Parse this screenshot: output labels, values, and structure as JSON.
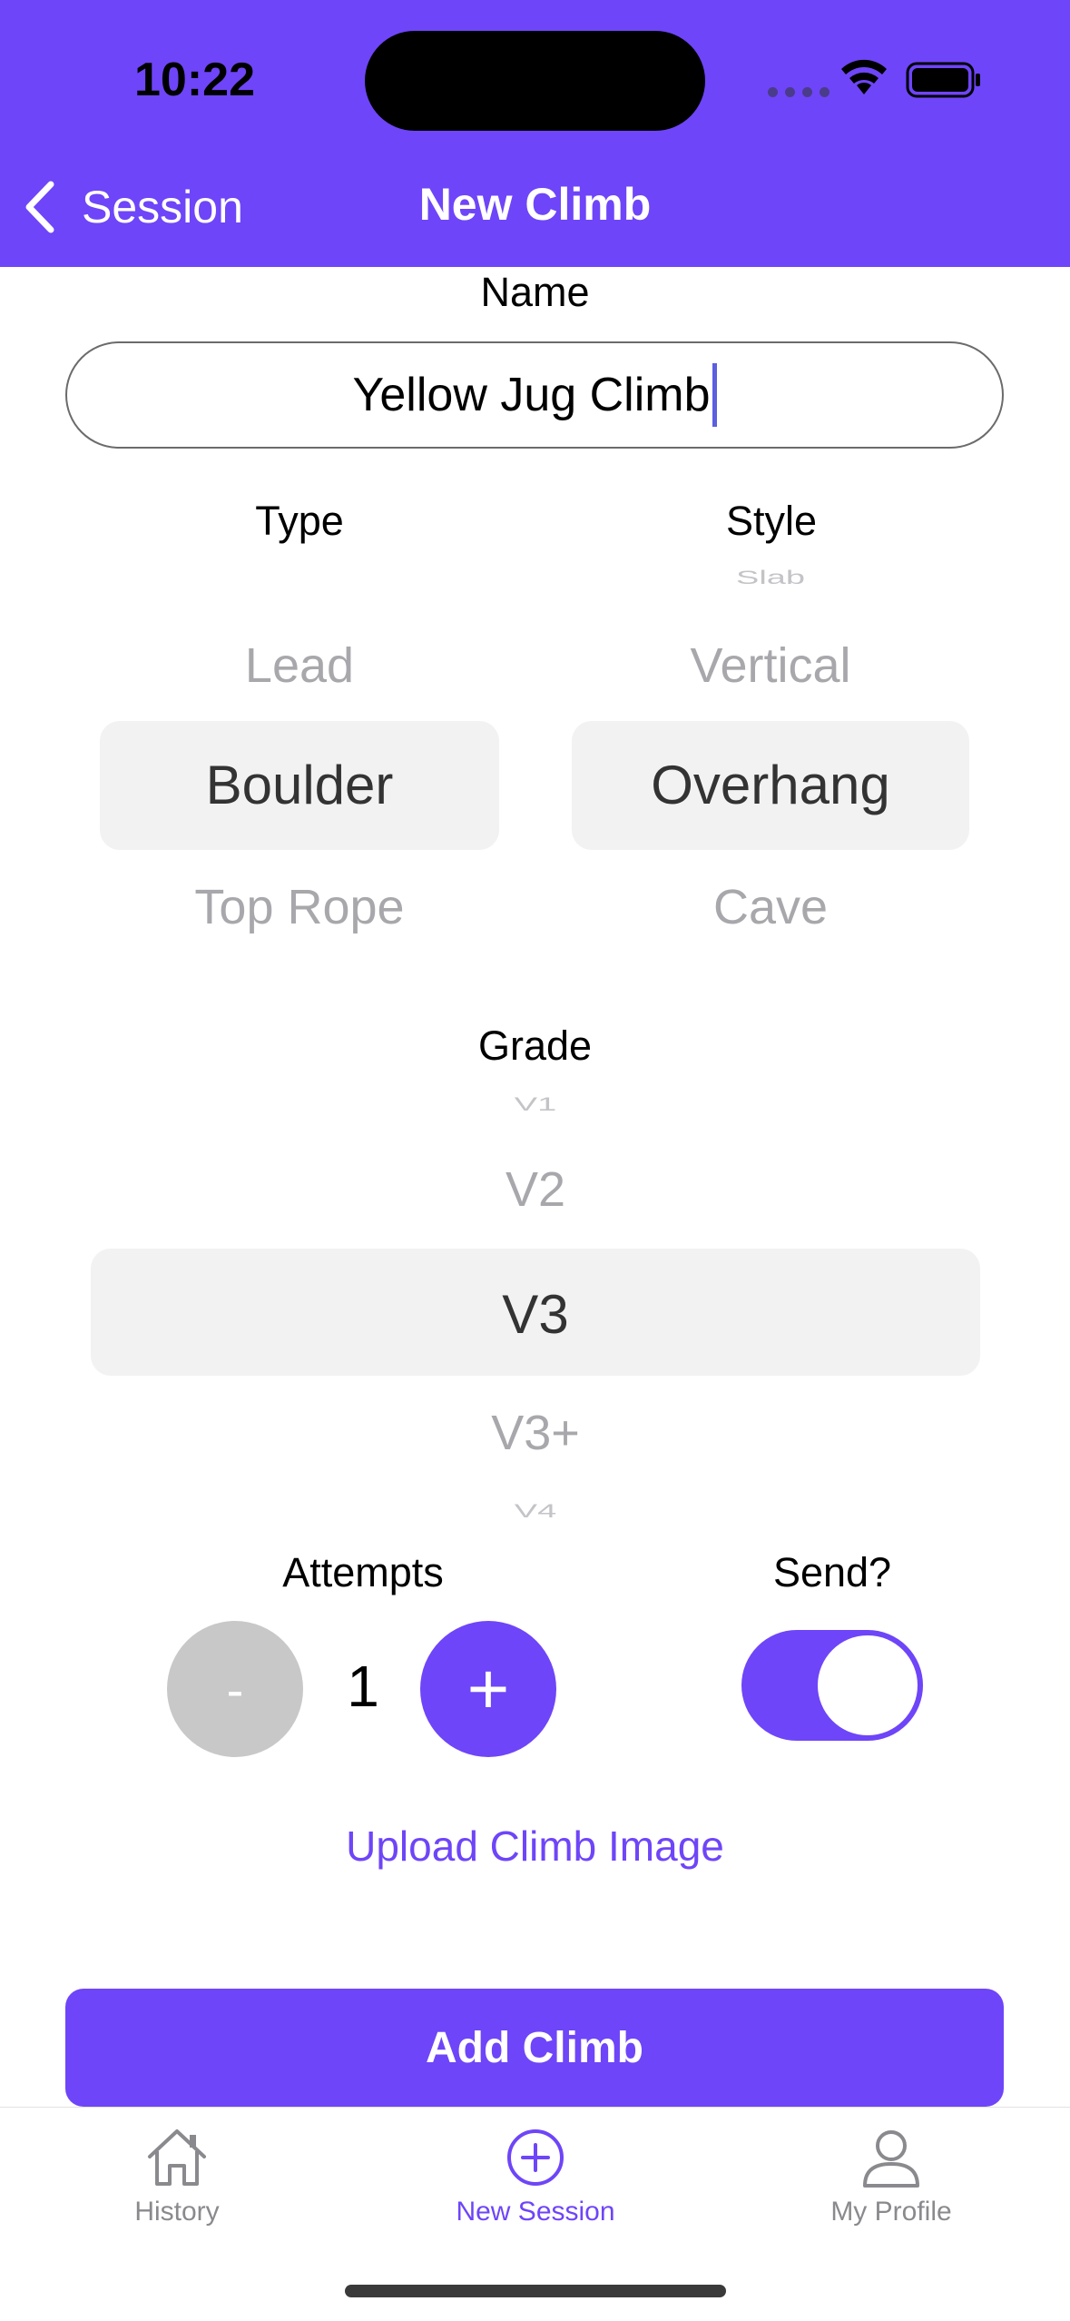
{
  "status_bar": {
    "time": "10:22"
  },
  "nav": {
    "back_label": "Session",
    "title": "New Climb"
  },
  "form": {
    "name_label": "Name",
    "name_value": "Yellow Jug Climb",
    "type_label": "Type",
    "style_label": "Style",
    "grade_label": "Grade",
    "attempts_label": "Attempts",
    "send_label": "Send?"
  },
  "type_picker": {
    "above": "Lead",
    "selected": "Boulder",
    "below": "Top Rope"
  },
  "style_picker": {
    "above2": "Slab",
    "above": "Vertical",
    "selected": "Overhang",
    "below": "Cave"
  },
  "grade_picker": {
    "above2": "V1",
    "above": "V2",
    "selected": "V3",
    "below": "V3+",
    "below2": "V4"
  },
  "stepper": {
    "minus_label": "-",
    "value": "1",
    "plus_label": "+"
  },
  "send_toggle": {
    "on": true
  },
  "upload_label": "Upload Climb Image",
  "add_button_label": "Add Climb",
  "tabs": [
    {
      "label": "History",
      "icon": "house-icon",
      "active": false
    },
    {
      "label": "New Session",
      "icon": "plus-circle-icon",
      "active": true
    },
    {
      "label": "My Profile",
      "icon": "person-icon",
      "active": false
    }
  ],
  "colors": {
    "accent": "#6e45f8",
    "inactive_tab": "#8a8a8e",
    "picker_highlight": "#f2f2f3"
  }
}
